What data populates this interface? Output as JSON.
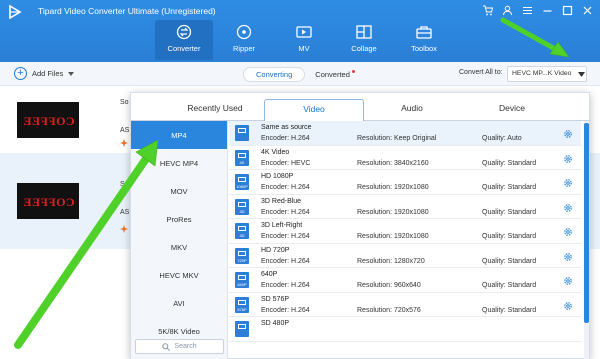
{
  "window": {
    "title": "Tipard Video Converter Ultimate (Unregistered)",
    "controls": [
      "cart-icon",
      "user-icon",
      "menu-icon",
      "minimize-icon",
      "maximize-icon",
      "close-icon"
    ]
  },
  "main_tabs": [
    {
      "label": "Converter",
      "icon": "convert-icon",
      "active": true
    },
    {
      "label": "Ripper",
      "icon": "disc-icon",
      "active": false
    },
    {
      "label": "MV",
      "icon": "mv-icon",
      "active": false
    },
    {
      "label": "Collage",
      "icon": "collage-icon",
      "active": false
    },
    {
      "label": "Toolbox",
      "icon": "toolbox-icon",
      "active": false
    }
  ],
  "toolbar": {
    "add_files_label": "Add Files",
    "converting_label": "Converting",
    "converted_label": "Converted",
    "convert_all_label": "Convert All to:",
    "convert_all_value": "HEVC MP...K Video"
  },
  "files": [
    {
      "thumb_text": "COFFEE",
      "name_fragment": "So",
      "format_fragment": "AS"
    },
    {
      "thumb_text": "COFFEE",
      "name_fragment": "So",
      "format_fragment": "AS"
    }
  ],
  "format_dialog": {
    "tabs": [
      {
        "label": "Recently Used",
        "active": false
      },
      {
        "label": "Video",
        "active": true
      },
      {
        "label": "Audio",
        "active": false
      },
      {
        "label": "Device",
        "active": false
      }
    ],
    "formats": [
      "MP4",
      "HEVC MP4",
      "MOV",
      "ProRes",
      "MKV",
      "HEVC MKV",
      "AVI",
      "5K/8K Video"
    ],
    "selected_format": "MP4",
    "search_placeholder": "Search",
    "presets": [
      {
        "name": "Same as source",
        "encoder": "Encoder: H.264",
        "resolution": "Resolution: Keep Original",
        "quality": "Quality: Auto",
        "badge": ""
      },
      {
        "name": "4K Video",
        "encoder": "Encoder: HEVC",
        "resolution": "Resolution: 3840x2160",
        "quality": "Quality: Standard",
        "badge": "4K"
      },
      {
        "name": "HD 1080P",
        "encoder": "Encoder: H.264",
        "resolution": "Resolution: 1920x1080",
        "quality": "Quality: Standard",
        "badge": "1080P"
      },
      {
        "name": "3D Red-Blue",
        "encoder": "Encoder: H.264",
        "resolution": "Resolution: 1920x1080",
        "quality": "Quality: Standard",
        "badge": "3D"
      },
      {
        "name": "3D Left-Right",
        "encoder": "Encoder: H.264",
        "resolution": "Resolution: 1920x1080",
        "quality": "Quality: Standard",
        "badge": "3D"
      },
      {
        "name": "HD 720P",
        "encoder": "Encoder: H.264",
        "resolution": "Resolution: 1280x720",
        "quality": "Quality: Standard",
        "badge": "720P"
      },
      {
        "name": "640P",
        "encoder": "Encoder: H.264",
        "resolution": "Resolution: 960x640",
        "quality": "Quality: Standard",
        "badge": "640P"
      },
      {
        "name": "SD 576P",
        "encoder": "Encoder: H.264",
        "resolution": "Resolution: 720x576",
        "quality": "Quality: Standard",
        "badge": "576P"
      },
      {
        "name": "SD 480P",
        "encoder": "",
        "resolution": "",
        "quality": "",
        "badge": ""
      }
    ]
  },
  "colors": {
    "accent": "#2a86dd",
    "title_bar": "#2f8de4",
    "arrow": "#4fd12a"
  }
}
